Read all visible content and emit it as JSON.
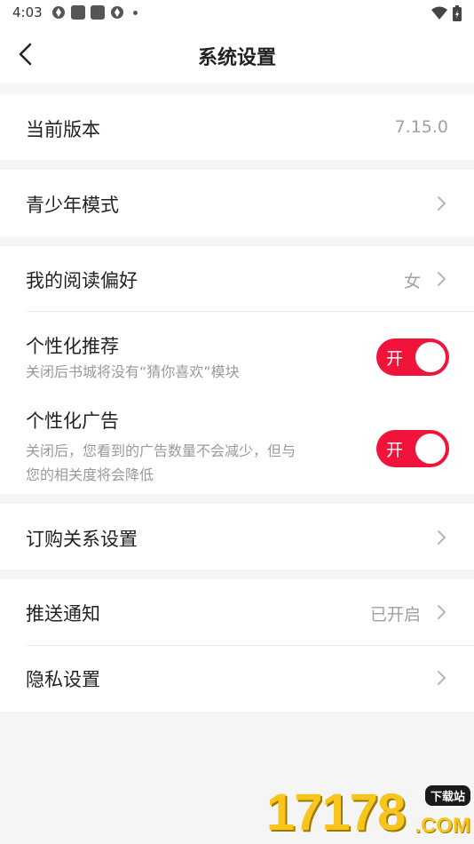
{
  "status_bar": {
    "time": "4:03"
  },
  "header": {
    "title": "系统设置"
  },
  "version": {
    "label": "当前版本",
    "value": "7.15.0"
  },
  "teen_mode": {
    "label": "青少年模式"
  },
  "reading_pref": {
    "label": "我的阅读偏好",
    "value": "女"
  },
  "personal_recommend": {
    "label": "个性化推荐",
    "desc": "关闭后书城将没有“猜你喜欢”模块",
    "toggle_text": "开"
  },
  "personal_ads": {
    "label": "个性化广告",
    "desc_line1": "关闭后，您看到的广告数量不会减少，但与",
    "desc_line2": "您的相关度将会降低",
    "toggle_text": "开"
  },
  "subscription": {
    "label": "订购关系设置"
  },
  "push": {
    "label": "推送通知",
    "value": "已开启"
  },
  "privacy": {
    "label": "隐私设置"
  },
  "watermark": {
    "number": "17178",
    "badge": "下载站",
    "domain": ".COM"
  },
  "colors": {
    "accent": "#f0133a",
    "background": "#f5f5f5",
    "secondary_text": "#9a9a9a"
  }
}
